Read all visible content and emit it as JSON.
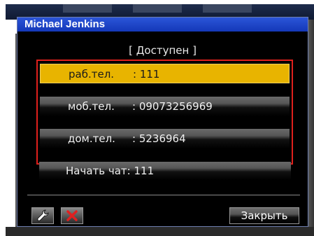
{
  "dialog": {
    "title": "Michael Jenkins",
    "status": "[ Доступен ]"
  },
  "phones": [
    {
      "label": "раб.тел.",
      "number": ": 111",
      "selected": true
    },
    {
      "label": "моб.тел.",
      "number": ": 09073256969",
      "selected": false
    },
    {
      "label": "дом.тел.",
      "number": ": 5236964",
      "selected": false
    }
  ],
  "chat": {
    "label": "Начать чат: 111"
  },
  "toolbar": {
    "edit_icon": "wrench-icon",
    "delete_icon": "x-icon",
    "close_label": "Закрыть"
  },
  "colors": {
    "titlebar": "#1f46c8",
    "selected_row": "#e8b400",
    "selection_border": "#e0201c",
    "delete_icon": "#e02020"
  }
}
